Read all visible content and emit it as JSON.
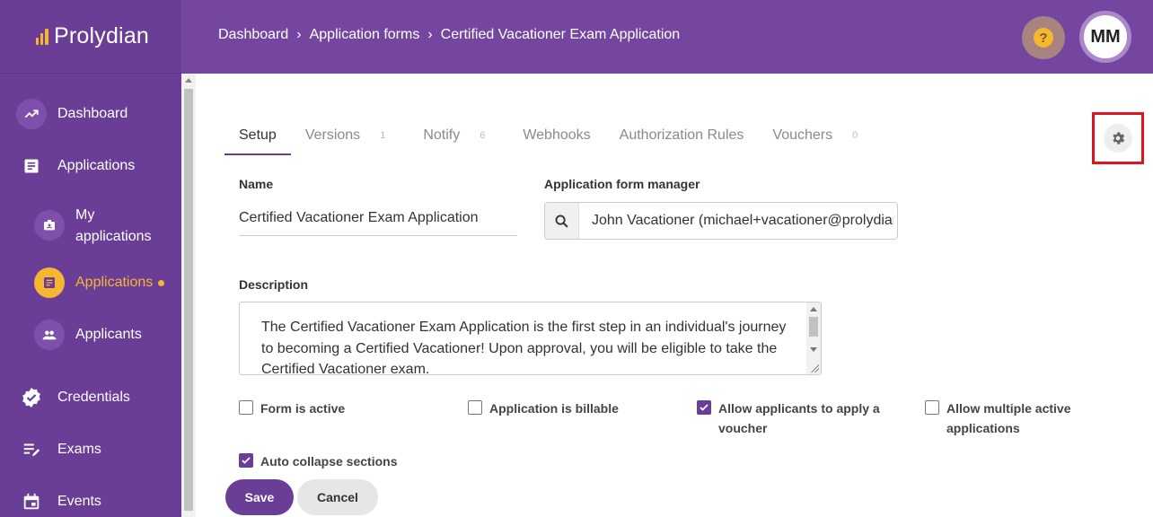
{
  "brand": {
    "name": "Prolydian",
    "accent": "#6a3d96",
    "highlight": "#f5b731"
  },
  "breadcrumb": [
    "Dashboard",
    "Application forms",
    "Certified Vacationer Exam Application"
  ],
  "user": {
    "initials": "MM"
  },
  "sidebar": {
    "items": [
      {
        "label": "Dashboard",
        "icon": "trending-up-icon"
      },
      {
        "label": "Applications",
        "icon": "document-icon"
      },
      {
        "label": "My applications",
        "icon": "badge-icon"
      },
      {
        "label": "Applications",
        "icon": "document-icon",
        "active": true
      },
      {
        "label": "Applicants",
        "icon": "people-icon"
      },
      {
        "label": "Credentials",
        "icon": "verified-icon"
      },
      {
        "label": "Exams",
        "icon": "edit-list-icon"
      },
      {
        "label": "Events",
        "icon": "calendar-icon"
      }
    ]
  },
  "tabs": [
    {
      "label": "Setup",
      "count": ""
    },
    {
      "label": "Versions",
      "count": "1"
    },
    {
      "label": "Notify",
      "count": "6"
    },
    {
      "label": "Webhooks",
      "count": ""
    },
    {
      "label": "Authorization Rules",
      "count": ""
    },
    {
      "label": "Vouchers",
      "count": "0"
    }
  ],
  "form": {
    "name_label": "Name",
    "name_value": "Certified  Vacationer Exam  Application",
    "manager_label": "Application form manager",
    "manager_value": "John Vacationer (michael+vacationer@prolydian.com)",
    "description_label": "Description",
    "description_value": "The Certified Vacationer Exam Application is the first step in an individual's journey to becoming a Certified Vacationer! Upon approval, you will be eligible to take the Certified Vacationer exam.",
    "checkboxes": [
      {
        "label": "Form is active",
        "checked": false
      },
      {
        "label": "Application is billable",
        "checked": false
      },
      {
        "label": "Allow applicants to apply a voucher",
        "checked": true
      },
      {
        "label": "Allow multiple active applications",
        "checked": false
      },
      {
        "label": "Auto collapse sections",
        "checked": true
      }
    ]
  },
  "actions": {
    "save": "Save",
    "cancel": "Cancel"
  }
}
